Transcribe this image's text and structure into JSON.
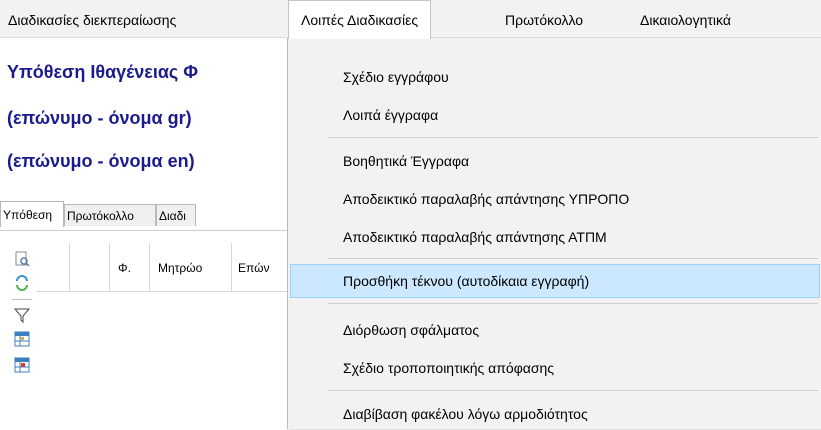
{
  "menubar": {
    "items": [
      {
        "label": "Διαδικασίες διεκπεραίωσης"
      },
      {
        "label": "Λοιπές Διαδικασίες"
      },
      {
        "label": "Πρωτόκολλο"
      },
      {
        "label": "Δικαιολογητικά"
      }
    ]
  },
  "case": {
    "title": "Υπόθεση Ιθαγένειας Φ",
    "name_gr": "(επώνυμο - όνομα gr)",
    "name_en": "(επώνυμο - όνομα en)"
  },
  "tabs": [
    {
      "label": "Υπόθεση"
    },
    {
      "label": "Πρωτόκολλο"
    },
    {
      "label": "Διαδι"
    }
  ],
  "grid": {
    "columns": [
      "Φ.",
      "Μητρώο",
      "Επών"
    ]
  },
  "dropdown": {
    "items": [
      {
        "label": "Σχέδιο εγγράφου"
      },
      {
        "label": "Λοιπά έγγραφα"
      },
      {
        "label": "Βοηθητικά Έγγραφα"
      },
      {
        "label": "Αποδεικτικό παραλαβής απάντησης ΥΠΡΟΠΟ"
      },
      {
        "label": "Αποδεικτικό παραλαβής απάντησης ΑΤΠΜ"
      },
      {
        "label": "Προσθήκη τέκνου (αυτοδίκαια εγγραφή)"
      },
      {
        "label": "Διόρθωση σφάλματος"
      },
      {
        "label": "Σχέδιο τροποποιητικής απόφασης"
      },
      {
        "label": "Διαβίβαση φακέλου λόγω αρμοδιότητος"
      }
    ],
    "highlighted_index": 5
  },
  "colors": {
    "case_title": "#1b1b8f",
    "menu_bg": "#f2f2f2",
    "highlight_bg": "#cce8ff",
    "highlight_border": "#99d1ff"
  },
  "icons": [
    "preview-icon",
    "refresh-icon",
    "filter-icon",
    "grid-icon",
    "grid-red-icon"
  ]
}
